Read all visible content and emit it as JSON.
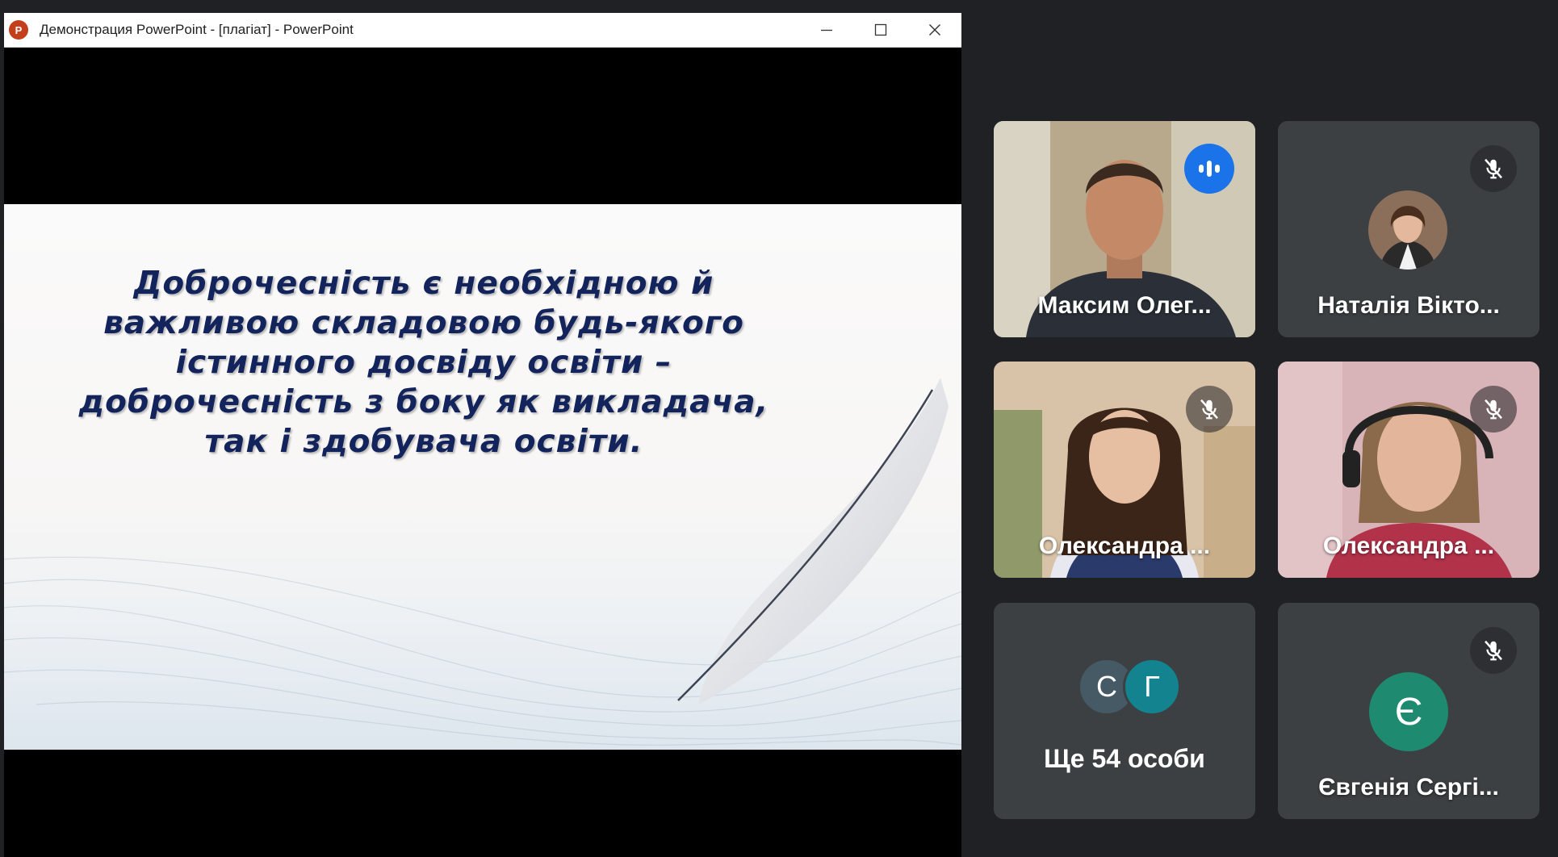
{
  "powerpoint": {
    "window_title": "Демонстрация PowerPoint - [плагіат] - PowerPoint",
    "app_icon_letter": "P",
    "controls": [
      "minimize-icon",
      "maximize-icon",
      "close-icon"
    ],
    "slide_text": "Доброчесність є необхідною й\nважливою складовою будь-якого\nістинного досвіду освіти –\nдоброчесність з боку як викладача,\nтак і здобувача освіти.",
    "slide_text_color": "#13245c"
  },
  "participants": {
    "tiles": [
      {
        "name": "Максим Олег...",
        "state": "speaking",
        "icon": "audio-level-icon"
      },
      {
        "name": "Наталія Вікто...",
        "state": "muted",
        "icon": "mic-off-icon"
      },
      {
        "name": "Олександра ...",
        "state": "muted",
        "icon": "mic-off-icon"
      },
      {
        "name": "Олександра ...",
        "state": "muted",
        "icon": "mic-off-icon"
      },
      {
        "more_avatars": [
          "С",
          "Г"
        ],
        "more_label": "Ще 54 особи"
      },
      {
        "name": "Євгенія Сергі...",
        "avatar_letter": "Є",
        "state": "muted",
        "icon": "mic-off-icon"
      }
    ],
    "colors": {
      "active_border": "#8ab4f8",
      "speaking_badge": "#1a73e8",
      "tile_bg": "#3c4043",
      "avatar_s": "#455a64",
      "avatar_g": "#12838f",
      "avatar_e": "#1e8a70"
    }
  }
}
